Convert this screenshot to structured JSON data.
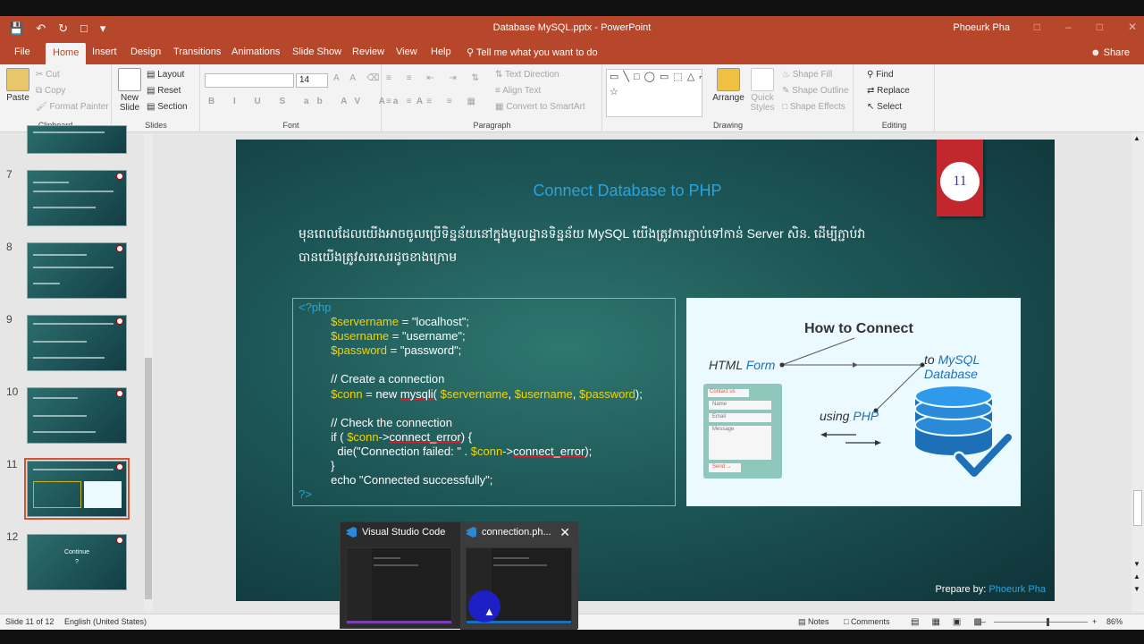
{
  "window": {
    "title": "Database MySQL.pptx  -  PowerPoint",
    "user": "Phoeurk Pha"
  },
  "tabs": [
    "File",
    "Home",
    "Insert",
    "Design",
    "Transitions",
    "Animations",
    "Slide Show",
    "Review",
    "View",
    "Help"
  ],
  "tell_me": "Tell me what you want to do",
  "share": "Share",
  "ribbon": {
    "clipboard": {
      "paste": "Paste",
      "cut": "Cut",
      "copy": "Copy",
      "format_painter": "Format Painter",
      "label": "Clipboard"
    },
    "slides": {
      "new_slide": "New Slide",
      "layout": "Layout",
      "reset": "Reset",
      "section": "Section",
      "label": "Slides"
    },
    "font": {
      "size": "14",
      "label": "Font"
    },
    "paragraph": {
      "text_direction": "Text Direction",
      "align_text": "Align Text",
      "convert": "Convert to SmartArt",
      "label": "Paragraph"
    },
    "drawing": {
      "arrange": "Arrange",
      "quick_styles": "Quick Styles",
      "shape_fill": "Shape Fill",
      "shape_outline": "Shape Outline",
      "shape_effects": "Shape Effects",
      "label": "Drawing"
    },
    "editing": {
      "find": "Find",
      "replace": "Replace",
      "select": "Select",
      "label": "Editing"
    }
  },
  "thumbnails": [
    {
      "num": "7",
      "selected": false
    },
    {
      "num": "8",
      "selected": false
    },
    {
      "num": "9",
      "selected": false
    },
    {
      "num": "10",
      "selected": false
    },
    {
      "num": "11",
      "selected": true
    },
    {
      "num": "12",
      "selected": false,
      "text": "Continue",
      "sub": "?"
    }
  ],
  "slide": {
    "number": "11",
    "title": "Connect Database to PHP",
    "khmer_line1": "មុនពេលដែលយើងអាចចូលប្រើទិន្នន័យនៅក្នុងមូលដ្ឋានទិន្នន័យ MySQL យើងត្រូវការភ្ជាប់ទៅកាន់ Server សិន. ដើម្បីភ្ជាប់វា",
    "khmer_line2": "បានយើងត្រូវសរសេរដូចខាងក្រោម",
    "code": {
      "open": "<?php",
      "l1_var": "$servername",
      "l1_rest": " = \"localhost\";",
      "l2_var": "$username",
      "l2_rest": " = \"username\";",
      "l3_var": "$password",
      "l3_rest": " = \"password\";",
      "c1": "// Create a connection",
      "l4_var": "$conn",
      "l4_mid": " = new ",
      "l4_fn": "mysqli",
      "l4_open": "( ",
      "l4_a1": "$servername",
      "sep": ", ",
      "l4_a2": "$username",
      "l4_a3": "$password",
      "l4_close": ");",
      "c2": "// Check the connection",
      "l5_a": "if ( ",
      "l5_var": "$conn",
      "l5_arrow": "->",
      "l5_prop": "connect_error",
      "l5_b": ") {",
      "l6_a": "die(\"Connection failed: \" . ",
      "l6_var": "$conn",
      "l6_arrow": "->",
      "l6_prop": "connect_error",
      "l6_b": ");",
      "l7": "}",
      "l8": "echo \"Connected successfully\";",
      "close": "?>"
    },
    "diagram": {
      "heading": "How to Connect",
      "html_form_a": "HTML ",
      "html_form_b": "Form",
      "to_mysql_a": "to ",
      "to_mysql_b": "MySQL",
      "to_mysql_c": "Database",
      "using_a": "using ",
      "using_b": "PHP",
      "form_header": "Contact us",
      "field_name": "Name",
      "field_email": "Email",
      "field_message": "Message",
      "send": "Send"
    },
    "prepare_label": "Prepare by: ",
    "prepare_name": "Phoeurk Pha"
  },
  "taskbar_popup": {
    "item1": "Visual Studio Code",
    "item2": "connection.ph..."
  },
  "status": {
    "slide": "Slide 11 of 12",
    "language": "English (United States)",
    "notes": "Notes",
    "comments": "Comments",
    "zoom": "86%"
  },
  "colors": {
    "accent": "#b7472a",
    "slide_title": "#29a3dd",
    "badge": "#c1272d",
    "var": "#f2d400"
  }
}
